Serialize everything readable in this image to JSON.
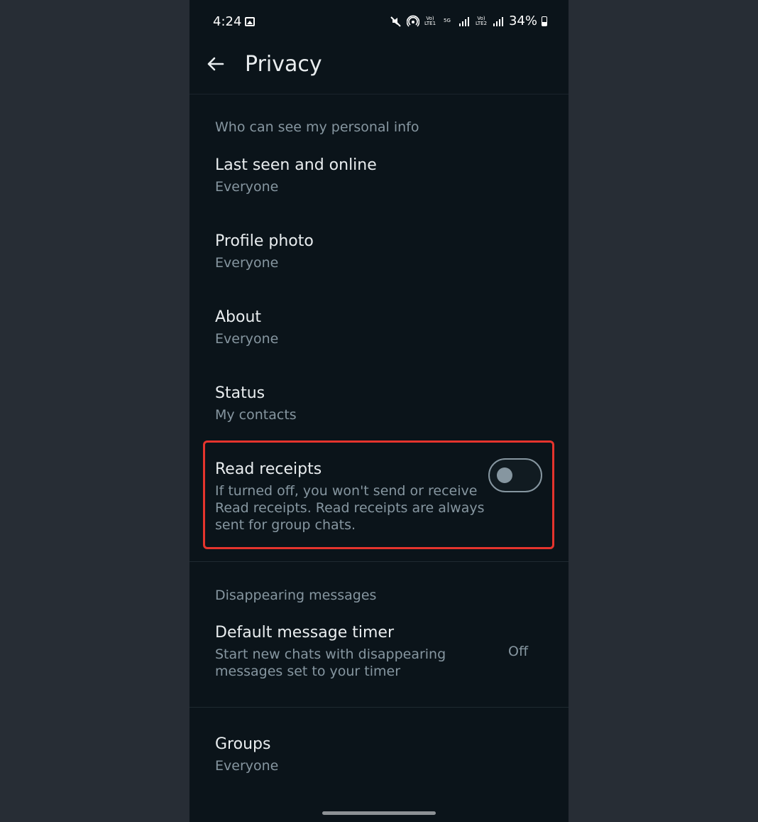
{
  "status_bar": {
    "time": "4:24",
    "volte1": "Vo) LTE1",
    "network_5g": "5G",
    "volte2": "Vo) LTE2",
    "battery": "34%"
  },
  "header": {
    "title": "Privacy"
  },
  "sections": {
    "personal_info": {
      "header": "Who can see my personal info",
      "items": [
        {
          "title": "Last seen and online",
          "value": "Everyone"
        },
        {
          "title": "Profile photo",
          "value": "Everyone"
        },
        {
          "title": "About",
          "value": "Everyone"
        },
        {
          "title": "Status",
          "value": "My contacts"
        }
      ]
    },
    "read_receipts": {
      "title": "Read receipts",
      "description": "If turned off, you won't send or receive\nRead receipts. Read receipts are always\nsent for group chats.",
      "enabled": false
    },
    "disappearing": {
      "header": "Disappearing messages",
      "timer_title": "Default message timer",
      "timer_description": "Start new chats with disappearing\nmessages set to your timer",
      "timer_value": "Off"
    },
    "groups": {
      "title": "Groups",
      "value": "Everyone"
    }
  },
  "colors": {
    "background": "#0b141a",
    "outer_background": "#272d35",
    "primary_text": "#e9edef",
    "secondary_text": "#8696a0",
    "highlight": "#e5342d"
  }
}
